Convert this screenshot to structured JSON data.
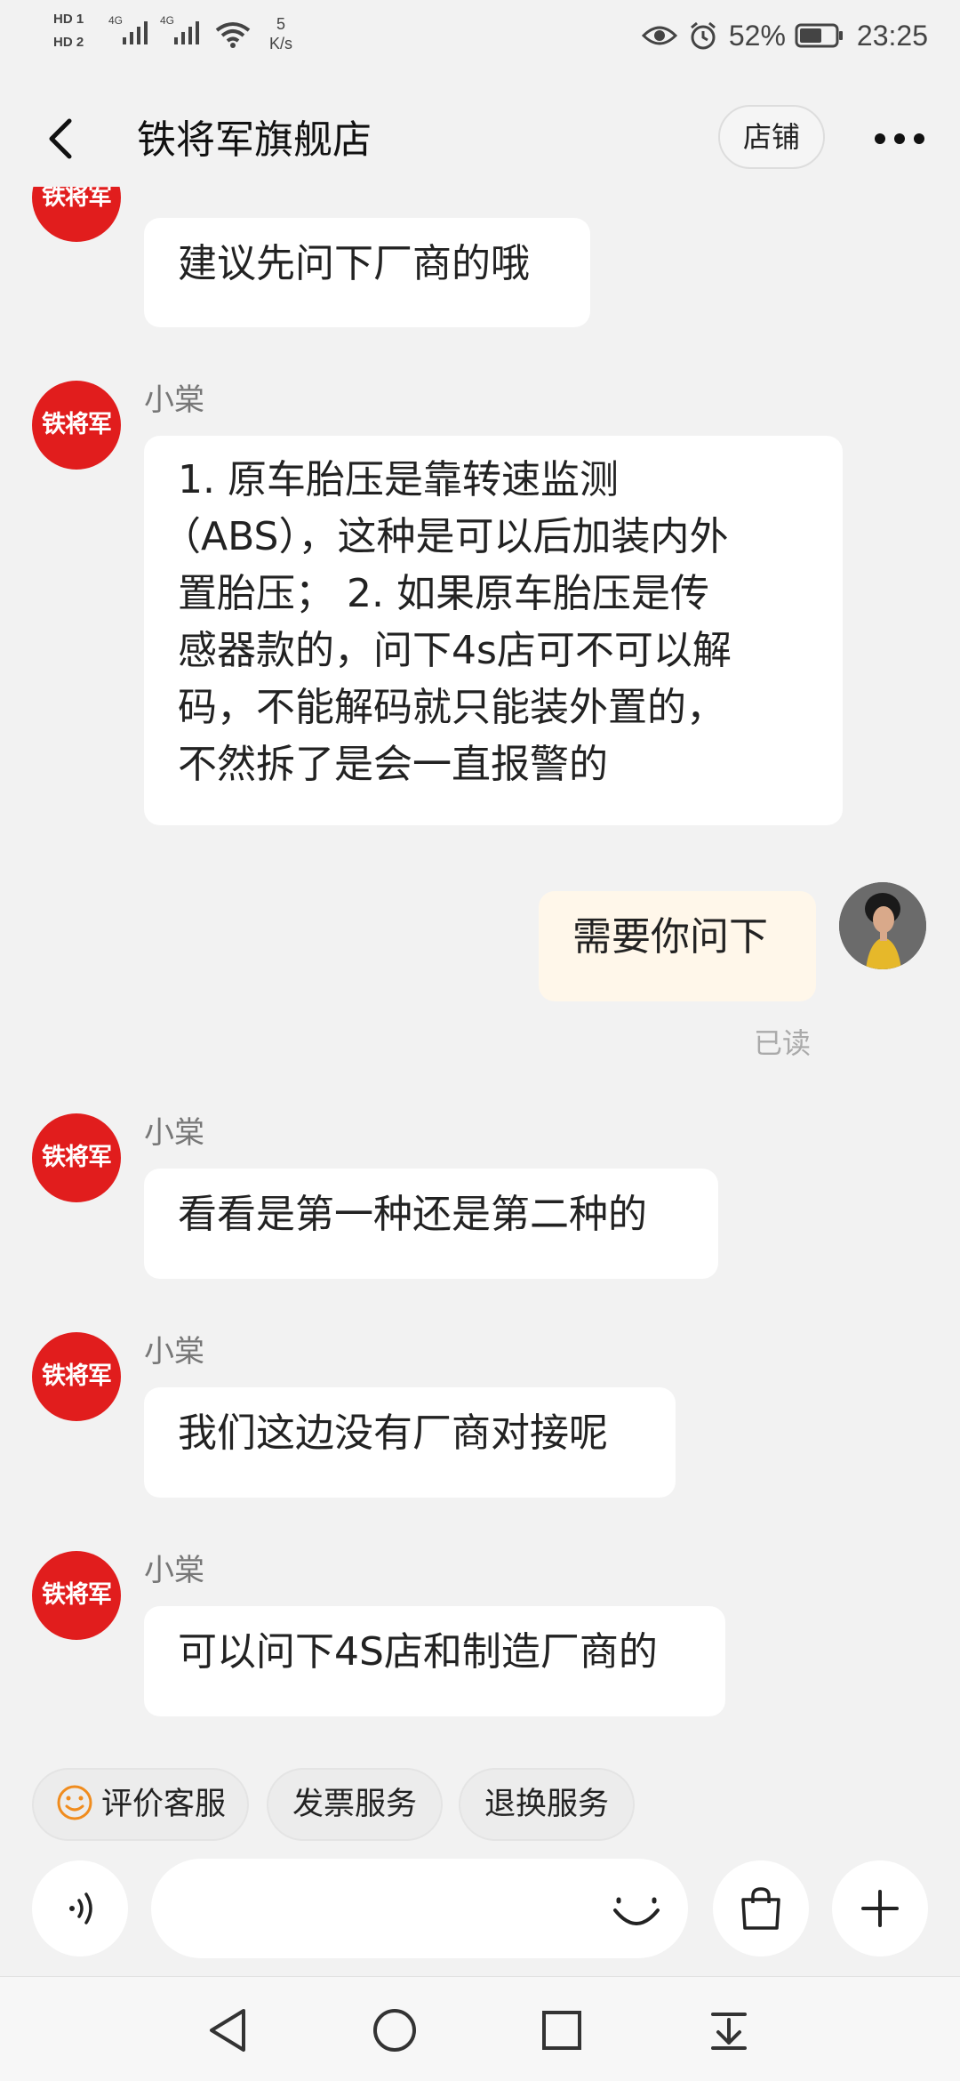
{
  "status_bar": {
    "hd1": "HD 1",
    "hd2": "HD 2",
    "sim1_network": "4G",
    "sim2_network": "4G",
    "net_speed_value": "5",
    "net_speed_unit": "K/s",
    "battery_percent": "52%",
    "time": "23:25",
    "icons": [
      "eye-icon",
      "alarm-icon",
      "battery-icon",
      "wifi-icon",
      "signal-icon"
    ]
  },
  "header": {
    "title": "铁将军旗舰店",
    "shop_button": "店铺",
    "more_icon": "more-icon",
    "back_icon": "back-arrow-icon"
  },
  "shop_avatar_text": "铁将军",
  "messages": [
    {
      "from": "shop",
      "sender": "",
      "text": "建议先问下厂商的哦"
    },
    {
      "from": "shop",
      "sender": "小棠",
      "lines": [
        "1. 原车胎压是靠转速监测",
        "（ABS），这种是可以后加装内外",
        "置胎压；  2. 如果原车胎压是传",
        "感器款的，问下4s店可不可以解",
        "码，不能解码就只能装外置的，",
        "不然拆了是会一直报警的"
      ]
    },
    {
      "from": "me",
      "text": "需要你问下",
      "status": "已读"
    },
    {
      "from": "shop",
      "sender": "小棠",
      "text": "看看是第一种还是第二种的"
    },
    {
      "from": "shop",
      "sender": "小棠",
      "text": "我们这边没有厂商对接呢"
    },
    {
      "from": "shop",
      "sender": "小棠",
      "text": "可以问下4S店和制造厂商的"
    }
  ],
  "quick_actions": [
    "评价客服",
    "发票服务",
    "退换服务"
  ],
  "input_bar": {
    "placeholder": "",
    "icons": [
      "voice-icon",
      "emoji-icon",
      "shopping-bag-icon",
      "plus-icon"
    ]
  },
  "nav_bar": {
    "icons": [
      "nav-back-icon",
      "nav-home-icon",
      "nav-recents-icon",
      "nav-notification-icon"
    ]
  },
  "colors": {
    "background": "#f2f2f2",
    "shop_avatar": "#e11d1d",
    "my_bubble": "#fff7ea",
    "accent_orange": "#f08c1e"
  }
}
